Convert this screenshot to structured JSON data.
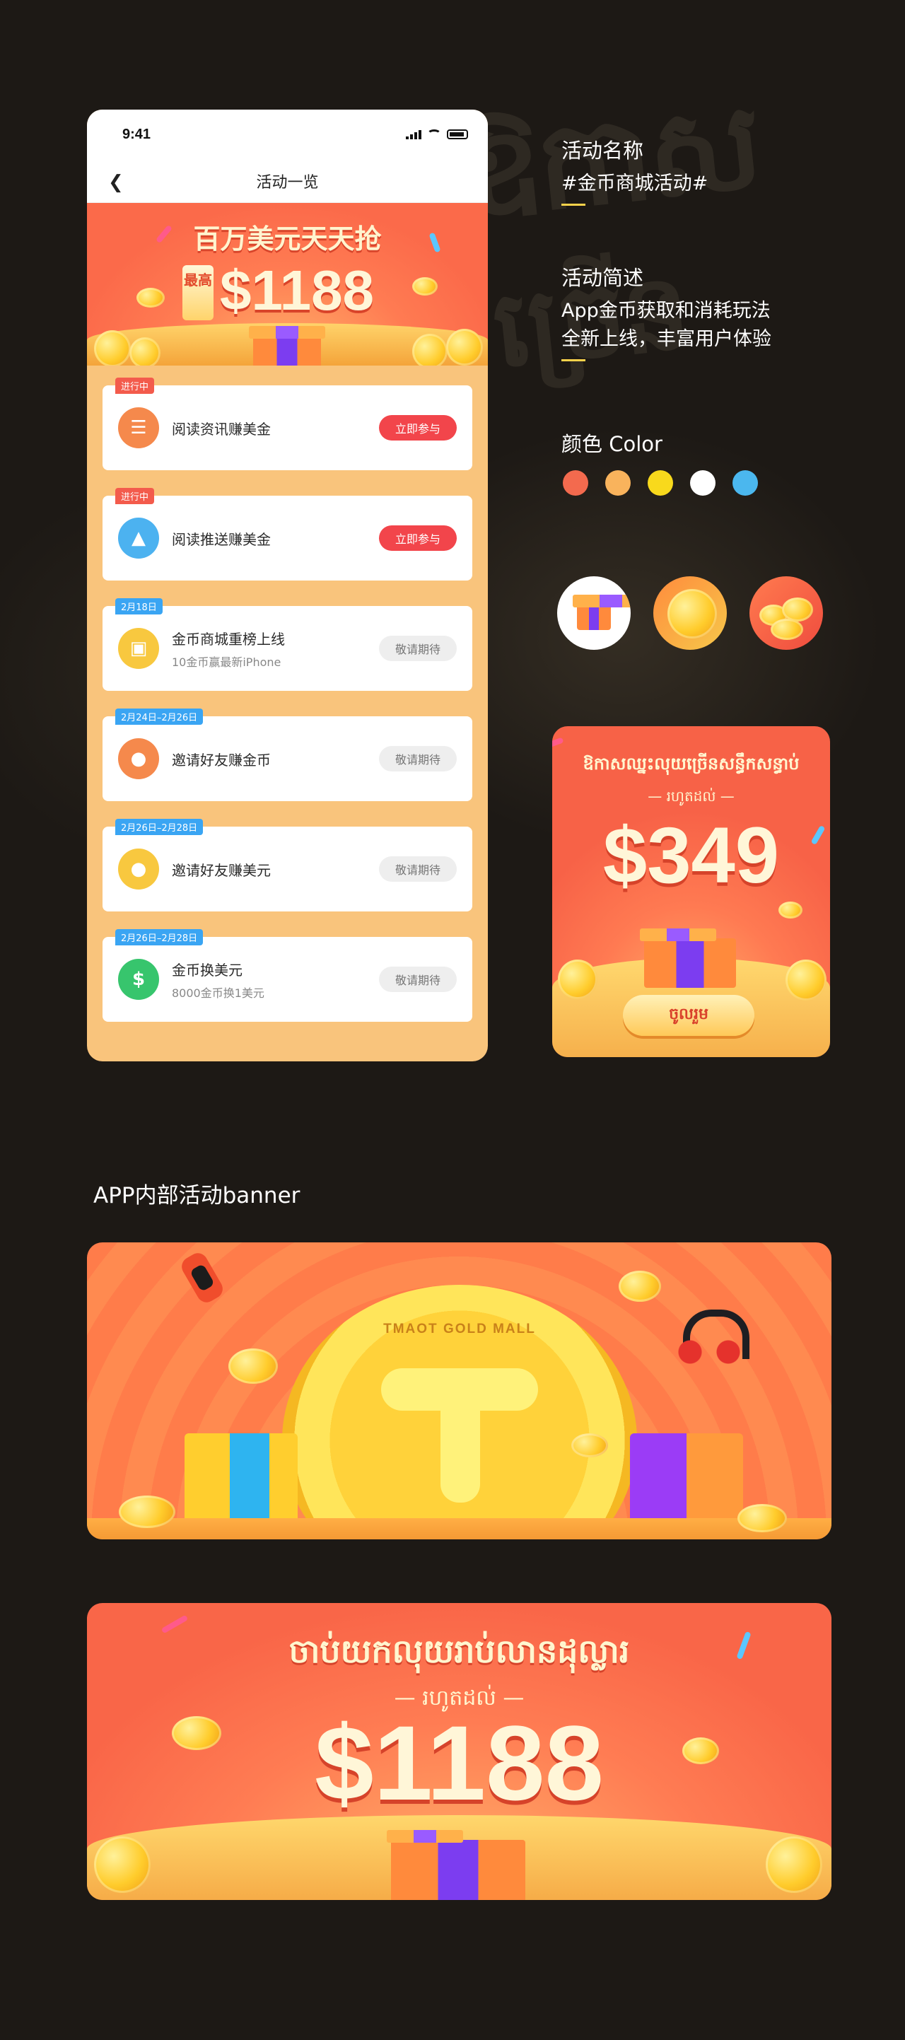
{
  "phone": {
    "status_time": "9:41",
    "nav_title": "活动一览",
    "hero": {
      "title": "百万美元天天抢",
      "tag": "最高",
      "amount": "$1188"
    },
    "cards": [
      {
        "badge": "进行中",
        "badge_color": "red",
        "icon": "document-icon",
        "title": "阅读资讯赚美金",
        "subtitle": "",
        "button": "立即参与",
        "button_style": "primary"
      },
      {
        "badge": "进行中",
        "badge_color": "red",
        "icon": "rocket-icon",
        "title": "阅读推送赚美金",
        "subtitle": "",
        "button": "立即参与",
        "button_style": "primary"
      },
      {
        "badge": "2月18日",
        "badge_color": "blue",
        "icon": "store-icon",
        "title": "金币商城重榜上线",
        "subtitle": "10金币赢最新iPhone",
        "button": "敬请期待",
        "button_style": "wait"
      },
      {
        "badge": "2月24日–2月26日",
        "badge_color": "blue",
        "icon": "invite-icon",
        "title": "邀请好友赚金币",
        "subtitle": "",
        "button": "敬请期待",
        "button_style": "wait"
      },
      {
        "badge": "2月26日–2月28日",
        "badge_color": "blue",
        "icon": "invite-dollar-icon",
        "title": "邀请好友赚美元",
        "subtitle": "",
        "button": "敬请期待",
        "button_style": "wait"
      },
      {
        "badge": "2月26日–2月28日",
        "badge_color": "blue",
        "icon": "exchange-icon",
        "title": "金币换美元",
        "subtitle": "8000金币换1美元",
        "button": "敬请期待",
        "button_style": "wait"
      }
    ]
  },
  "info": {
    "name_label": "活动名称",
    "name_value": "#金币商城活动#",
    "desc_label": "活动简述",
    "desc_line1": "App金币获取和消耗玩法",
    "desc_line2": "全新上线，丰富用户体验",
    "color_label": "颜色 Color",
    "colors": [
      "#f36a4e",
      "#f9b35c",
      "#f8d91c",
      "#ffffff",
      "#4bb7ee"
    ]
  },
  "promo": {
    "title": "ឱកាសឈ្នះលុយច្រើនសន្ធឹកសន្ធាប់",
    "subtitle": "— រហូតដល់ —",
    "amount": "$349",
    "button": "ចូលរួម"
  },
  "section_title": "APP内部活动banner",
  "banner1": {
    "coin_text": "TMAOT GOLD MALL"
  },
  "banner2": {
    "title": "ចាប់យកលុយរាប់លានដុល្លារ",
    "subtitle": "— រហូតដល់ —",
    "amount": "$1188"
  }
}
